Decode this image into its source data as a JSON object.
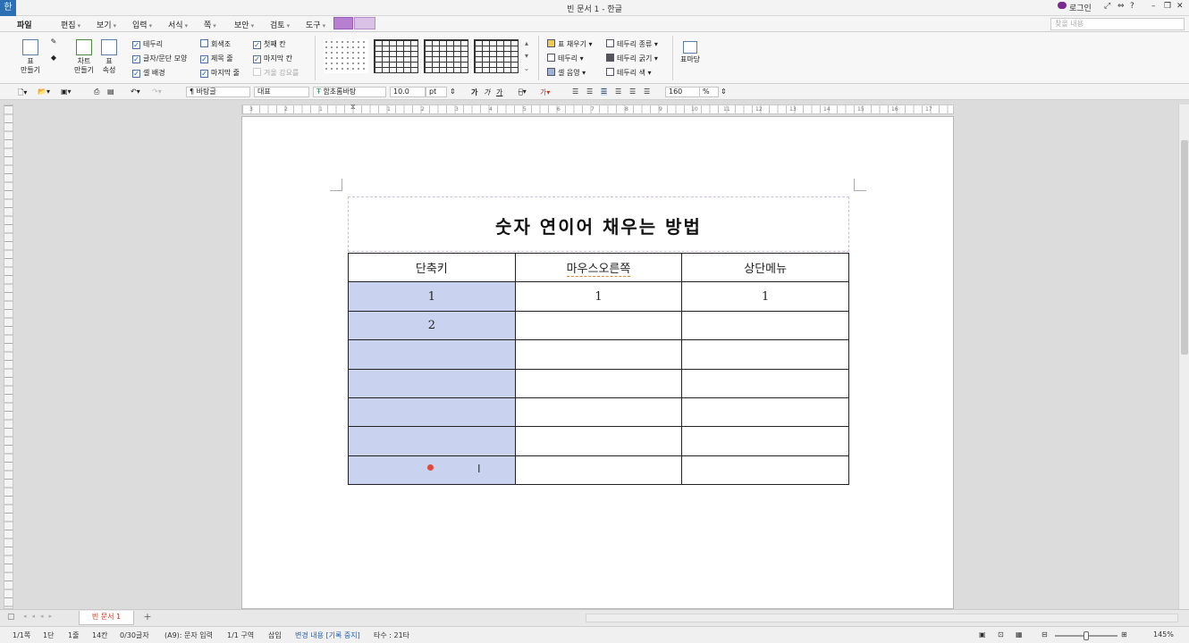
{
  "titlebar": {
    "logo": "한",
    "title": "빈 문서 1 - 한글",
    "login": "로그인",
    "help": "?"
  },
  "menubar": {
    "items": [
      "파일",
      "편집",
      "보기",
      "입력",
      "서식",
      "쪽",
      "보안",
      "검토",
      "도구"
    ],
    "search_placeholder": "찾을 내용"
  },
  "ribbon": {
    "table_make": [
      "표",
      "만들기"
    ],
    "chart_make": [
      "차트",
      "만들기"
    ],
    "table_props": [
      "표",
      "속성"
    ],
    "checks_col1": [
      "테두리",
      "글자/문단 모양",
      "셀 배경"
    ],
    "checks_col2": [
      "회색조",
      "제목 줄",
      "마지막 줄"
    ],
    "checks_col3": [
      "첫째 칸",
      "마지막 칸",
      "겨울 강요를"
    ],
    "fill_group": [
      "표 채우기",
      "테두리",
      "셀 음영"
    ],
    "border_group": [
      "테두리 종류",
      "테두리 굵기",
      "테두리 색"
    ],
    "table_wizard": "표마당"
  },
  "formatbar": {
    "style": "바탕글",
    "lang": "대표",
    "font": "함초롬바탕",
    "size": "10.0",
    "unit": "pt",
    "zoom": "160",
    "zoom_unit": "%",
    "bold": "가",
    "italic": "가",
    "underline": "가"
  },
  "ruler": {
    "numbers": [
      "3",
      "2",
      "1",
      "1",
      "2",
      "3",
      "4",
      "5",
      "6",
      "7",
      "8",
      "9",
      "10",
      "11",
      "12",
      "13",
      "14",
      "15",
      "16",
      "17"
    ]
  },
  "document": {
    "title": "숫자 연이어 채우는 방법",
    "headers": [
      "단축키",
      "마우스오른쪽",
      "상단메뉴"
    ],
    "rows": [
      [
        "1",
        "1",
        "1"
      ],
      [
        "2",
        "",
        ""
      ],
      [
        "",
        "",
        ""
      ],
      [
        "",
        "",
        ""
      ],
      [
        "",
        "",
        ""
      ],
      [
        "",
        "",
        ""
      ],
      [
        "",
        "",
        ""
      ]
    ]
  },
  "tabs": {
    "doc_tab": "빈 문서 1",
    "add": "+"
  },
  "status": {
    "page": "1/1쪽",
    "col": "1단",
    "line": "1줄",
    "char": "14칸",
    "count": "0/30글자",
    "mode": "(A9): 문자 입력",
    "section": "1/1 구역",
    "insert": "삽입",
    "track": "변경 내용 [기록 중지]",
    "typing": "타수 : 21타",
    "zoom": "145%"
  }
}
